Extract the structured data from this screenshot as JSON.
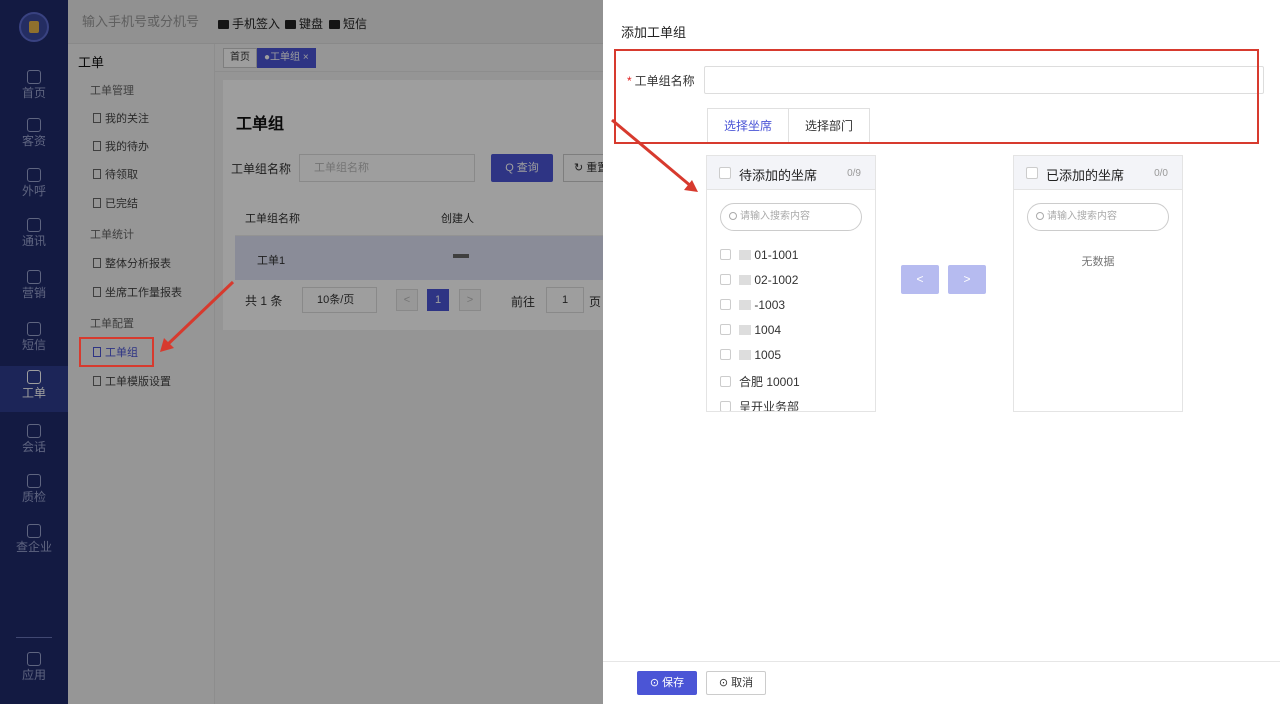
{
  "rail": {
    "items": [
      {
        "label": "首页",
        "icon": "home-icon"
      },
      {
        "label": "客资",
        "icon": "contacts-icon"
      },
      {
        "label": "外呼",
        "icon": "phone-icon"
      },
      {
        "label": "通讯",
        "icon": "directory-icon"
      },
      {
        "label": "营销",
        "icon": "marketing-icon"
      },
      {
        "label": "短信",
        "icon": "sms-icon"
      },
      {
        "label": "工单",
        "icon": "ticket-icon"
      },
      {
        "label": "会话",
        "icon": "chat-icon"
      },
      {
        "label": "质检",
        "icon": "quality-icon"
      },
      {
        "label": "查企业",
        "icon": "building-icon"
      },
      {
        "label": "应用",
        "icon": "apps-icon"
      }
    ]
  },
  "topbar": {
    "dial_placeholder": "输入手机号或分机号",
    "phone_checkin": "手机签入",
    "keypad": "键盘",
    "sms": "短信"
  },
  "submenu": {
    "title": "工单",
    "group_manage": "工单管理",
    "my_follow": "我的关注",
    "my_todo": "我的待办",
    "to_claim": "待领取",
    "completed": "已完结",
    "group_stats": "工单统计",
    "overall_report": "整体分析报表",
    "agent_report": "坐席工作量报表",
    "group_config": "工单配置",
    "ticket_group": "工单组",
    "template_settings": "工单模版设置"
  },
  "tabs": {
    "home": "首页",
    "current": "●工单组 ×"
  },
  "main": {
    "heading": "工单组",
    "filter_label": "工单组名称",
    "filter_placeholder": "工单组名称",
    "query": "Q 查询",
    "reset": "↻ 重置",
    "col_name": "工单组名称",
    "col_creator": "创建人",
    "row_name": "工单1",
    "total": "共 1 条",
    "page_size": "10条/页",
    "prev": "<",
    "current_page": "1",
    "next": ">",
    "goto": "前往",
    "goto_page": "1",
    "page_unit": "页"
  },
  "drawer": {
    "title": "添加工单组",
    "name_label": "工单组名称",
    "tab_agents": "选择坐席",
    "tab_departments": "选择部门",
    "left_title": "待添加的坐席",
    "left_count": "0/9",
    "right_title": "已添加的坐席",
    "right_count": "0/0",
    "search_placeholder": "请输入搜索内容",
    "empty": "无数据",
    "items": [
      "01-1001",
      "02-1002",
      "-1003",
      "1004",
      "1005",
      "合肥 10001",
      "呈开业务部"
    ],
    "move_left": "<",
    "move_right": ">",
    "save": "保存",
    "cancel": "取消"
  },
  "colors": {
    "accent": "#4b55d6",
    "rail": "#1f2a6b",
    "annotation": "#d73a2e"
  }
}
